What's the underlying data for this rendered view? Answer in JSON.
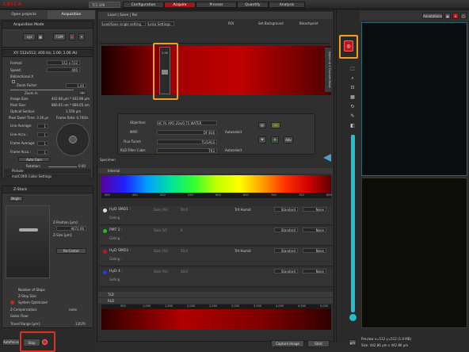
{
  "app": {
    "logo": "LEICA",
    "system": "TCS SP8"
  },
  "workflow": [
    "Configuration",
    "Acquire",
    "Process",
    "Quantify",
    "Analysis"
  ],
  "left": {
    "tabs": [
      "Open projects",
      "Acquisition"
    ],
    "acq_mode": {
      "title": "Acquisition Mode",
      "mode": "xyz",
      "flim": "FLIM"
    },
    "xy": {
      "title": "XY: 512x512; 400 Hz; 1.00; 1.00 AU",
      "format_label": "Format:",
      "format": "512 x 512",
      "speed_label": "Speed:",
      "speed": "400",
      "bidir": "Bidirectional X",
      "zoom_factor_label": "Zoom Factor:",
      "zoom_factor": "1.00",
      "zoom_in": "Zoom In",
      "image_size_label": "Image Size:",
      "image_size": "442.86 µm * 442.86 µm",
      "pixel_size_label": "Pixel Size:",
      "pixel_size": "866.65 nm * 866.65 nm",
      "optical_section_label": "Optical Section:",
      "optical_section": "1.559 µm",
      "dwell": "Pixel Dwell Time: 3.16 µs",
      "frame_rate": "Frame Rate: 0.740/s",
      "line_avg": "Line Average:",
      "line_acc": "Line Accu.:",
      "frame_avg": "Frame Average:",
      "frame_acc": "Frame Accu.:",
      "one": "1",
      "auto_gain": "Auto Gain",
      "rotation_label": "Rotation:",
      "rotation": "0.00",
      "pinhole": "Pinhole",
      "motcorr": "motCORR Collar Settings"
    },
    "zstack": {
      "title": "Z-Stack",
      "begin": "Begin",
      "zpos_label": "Z-Position [µm]:",
      "zpos": "9072.06",
      "zsize_label": "Z-Size [µm]:",
      "re_center": "Re-Center",
      "num_steps": "Number of Steps",
      "step_size": "Z-Step Size",
      "sys_opt": "System Optimized",
      "z_comp": "Z-Compensation:",
      "z_comp_val": "none",
      "galvo": "Galvo Flow:",
      "travel_label": "Travel Range [µm]:",
      "travel": "13070"
    },
    "bottom": {
      "autofocus": "Autofocus",
      "stop": "Stop"
    }
  },
  "center": {
    "tabs": {
      "load": "Load | Save | Roi"
    },
    "roi_label": "ROI",
    "set_bg": "Set Background",
    "bleachpoint": "Bleachpoint",
    "load_dropdown": "Load/Save single setting",
    "leica_settings": "Leica Settings",
    "slider_value": "2.90",
    "side_label": "Switch to 1 Channel Mode",
    "objective_label": "Objective:",
    "objective": "HC PL APO    20x/0.75 WATER",
    "mp_label": "MP/F:",
    "mp": "DF 816",
    "autoselect": "Autoselect",
    "flu_label": "Fluo Turret:",
    "flu": "TL/GALS",
    "rld_label": "RLD Filter Cube:",
    "rld": "TR3",
    "adv": "Adv",
    "specimen": "Specimen",
    "internal": "Internal",
    "wl_ticks": [
      "400",
      "450",
      "500",
      "550",
      "600",
      "650",
      "700",
      "750",
      "800"
    ],
    "detectors": [
      {
        "name": "HyD SMD1 :",
        "gain": "Gain [%]:",
        "gain_val": "50.0",
        "dye": "Trit Humid",
        "mode": "Standard",
        "lut": "None",
        "color": "#e0e0e0"
      },
      {
        "name": "PMT 2 :",
        "gain": "Gain [V]:",
        "gain_val": "0",
        "dye": "",
        "mode": "Standard",
        "lut": "None",
        "color": "#20c020"
      },
      {
        "name": "HyD SMD3 :",
        "gain": "Gain [%]:",
        "gain_val": "50.0",
        "dye": "Trit Humid",
        "mode": "Standard",
        "lut": "None",
        "color": "#c01818"
      },
      {
        "name": "HyD 4 :",
        "gain": "Gain [%]:",
        "gain_val": "50.0",
        "dye": "",
        "mode": "Standard",
        "lut": "None",
        "color": "#2040e0"
      }
    ],
    "gating": "Gating :",
    "tld": "TLD",
    "rld2": "RLD",
    "rld_ticks": [
      "500",
      "1,000",
      "1,500",
      "2,000",
      "2,500",
      "3,000",
      "3,500",
      "4,000",
      "4,500",
      "5,000"
    ],
    "capture": "Capture Image",
    "start": "Start"
  },
  "right": {
    "annotations": "Annotations",
    "preview": "Preview x=512 y=512 (1.0 MB)",
    "size": "Size: 442.86 µm x 442.86 µm",
    "zoom": "µm"
  }
}
